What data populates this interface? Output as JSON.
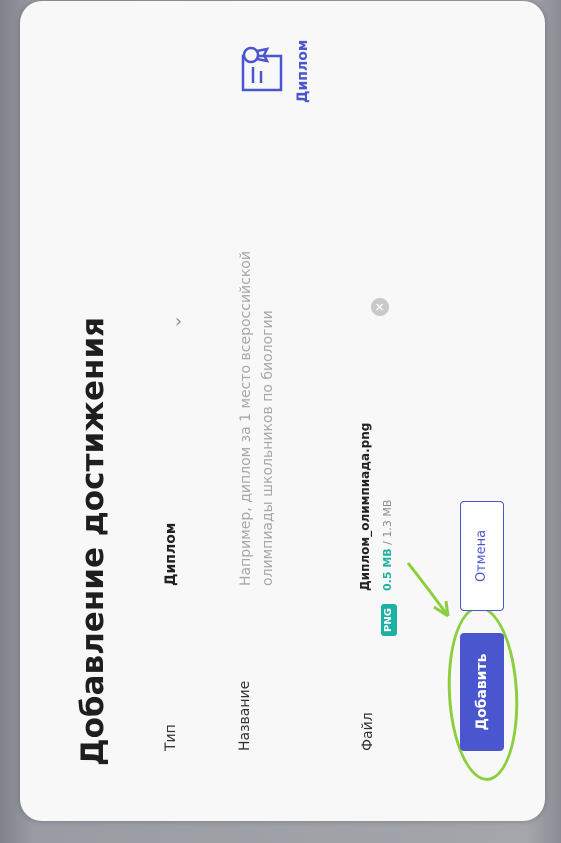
{
  "dialog": {
    "title": "Добавление достижения"
  },
  "form": {
    "type_label": "Тип",
    "type_value": "Диплом",
    "name_label": "Название",
    "name_placeholder": "Например, диплом за 1 место всероссийской олимпиады школьников по биологии",
    "file_label": "Файл"
  },
  "file": {
    "badge": "PNG",
    "name": "Диплом_олимпиада.png",
    "size_used": "0.5 MB",
    "size_separator": " / ",
    "size_total": "1.3 MB"
  },
  "actions": {
    "add_label": "Добавить",
    "cancel_label": "Отмена"
  },
  "type_tile": {
    "label": "Диплом",
    "icon": "diploma-icon"
  },
  "colors": {
    "accent": "#4a56cd",
    "png_badge": "#1db1a5",
    "annotation": "#8ccf3c"
  }
}
